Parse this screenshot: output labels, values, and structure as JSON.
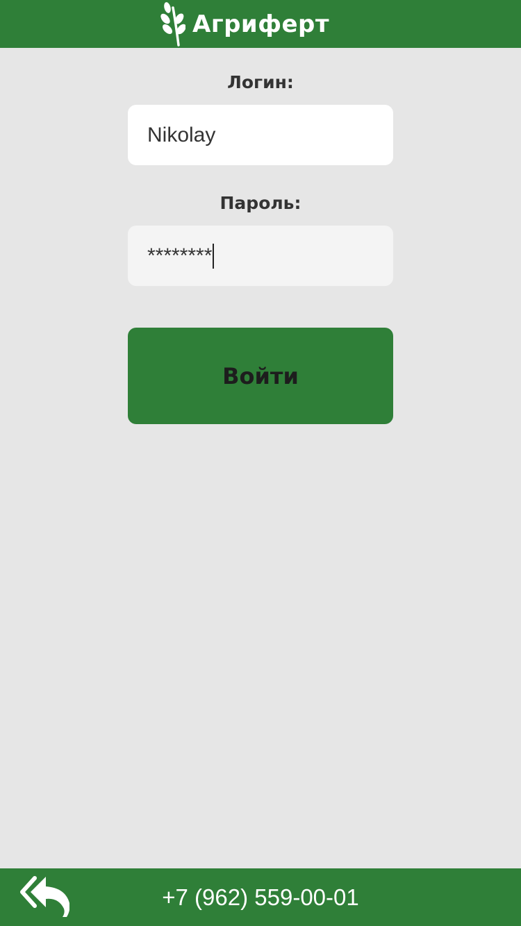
{
  "header": {
    "brand_name": "Агриферт",
    "logo_icon": "wheat-icon",
    "background_color": "#2f7f38"
  },
  "form": {
    "login_label": "Логин:",
    "login_value": "Nikolay",
    "password_label": "Пароль:",
    "password_value": "********",
    "submit_label": "Войти"
  },
  "footer": {
    "back_icon": "double-reply-arrow-icon",
    "phone": "+7 (962) 559-00-01"
  },
  "colors": {
    "accent": "#2f7f38",
    "page_background": "#e6e6e6"
  }
}
